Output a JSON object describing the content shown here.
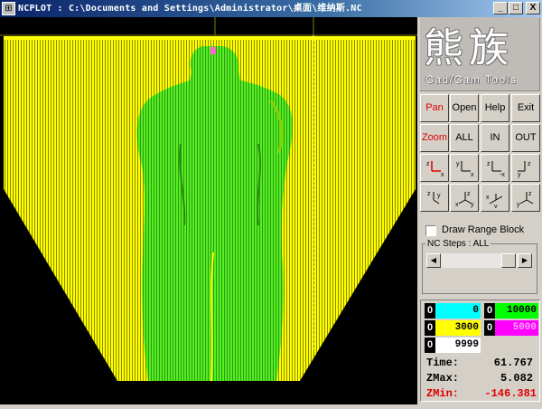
{
  "window": {
    "title": "NCPLOT : C:\\Documents and Settings\\Administrator\\桌面\\维纳斯.NC",
    "controls": [
      "_",
      "□",
      "X"
    ]
  },
  "logo": {
    "chinese": "熊族",
    "subtitle": "Cad/Cam Tools"
  },
  "toolbar": {
    "row1": [
      {
        "label": "Pan",
        "color": "#e00000"
      },
      {
        "label": "Open"
      },
      {
        "label": "Help"
      },
      {
        "label": "Exit"
      }
    ],
    "row2": [
      {
        "label": "Zoom",
        "color": "#e00000"
      },
      {
        "label": "ALL"
      },
      {
        "label": "IN"
      },
      {
        "label": "OUT"
      }
    ],
    "view_icons": [
      "view-zx-icon",
      "view-yx-icon",
      "view-z-minus-x-icon",
      "view-zy-icon",
      "view-zy-iso-icon",
      "view-xz-icon",
      "view-xy-icon",
      "view-yz-icon"
    ]
  },
  "range_block": {
    "label": "Draw Range Block",
    "checked": false
  },
  "nc_steps": {
    "label": "NC Steps : ALL"
  },
  "color_legend": [
    {
      "index": "0",
      "value": "0",
      "color": "#00ffff"
    },
    {
      "index": "0",
      "value": "10000",
      "color": "#00ff00"
    },
    {
      "index": "0",
      "value": "3000",
      "color": "#ffff00"
    },
    {
      "index": "0",
      "value": "5000",
      "color": "#ff00ff"
    },
    {
      "index": "0",
      "value": "9999",
      "color": "#ffffff"
    }
  ],
  "stats": {
    "time_label": "Time:",
    "time_value": "61.767",
    "zmax_label": "ZMax:",
    "zmax_value": "5.082",
    "zmin_label": "ZMin:",
    "zmin_value": "-146.381"
  },
  "colors": {
    "toolpath_yellow": "#ffff00",
    "toolpath_green": "#55ee22",
    "background": "#000000",
    "accent_red": "#e00000"
  }
}
